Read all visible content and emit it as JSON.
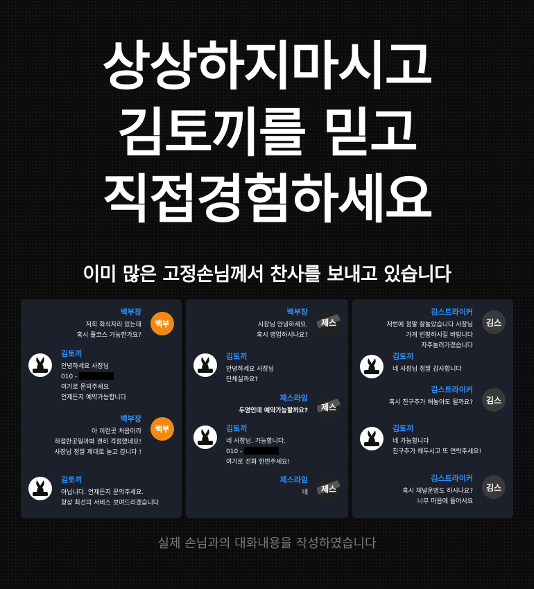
{
  "headline": {
    "line1": "상상하지마시고",
    "line2": "김토끼를 믿고",
    "line3": "직접경험하세요"
  },
  "subhead": "이미 많은 고정손님께서 찬사를 보내고 있습니다",
  "footer": "실제 손님과의 대화내용을 작성하였습니다",
  "colors": {
    "name_blue": "#2f8fff",
    "avatar_orange": "#f28a12",
    "panel_bg": "#1b202a",
    "background": "#0b0b0c"
  },
  "panels": [
    {
      "messages": [
        {
          "sender": "백부장",
          "lines": [
            "저희 회식자리 있는데",
            "혹시 풀코스 가능한가요?"
          ],
          "avatar_label": "백부"
        },
        {
          "sender": "김토끼",
          "lines": [
            "안녕하세요 사장님",
            "010 -",
            "여기로 문의주세요",
            "언제든지 예약가능합니다"
          ],
          "avatar_icon": "bunny-logo-icon"
        },
        {
          "sender": "백부장",
          "lines": [
            "아 이런곳 처음이라",
            "하접한곳일까봐 괜히 걱정했네요!",
            "사장님 정말 제대로 놀고 갑니다 !"
          ],
          "avatar_label": "백부"
        },
        {
          "sender": "김토끼",
          "lines": [
            "아닙니다. 언제든지 문의주세요.",
            "항상 최선의 서비스 보여드리겠습니다"
          ],
          "avatar_icon": "bunny-logo-icon"
        }
      ]
    },
    {
      "messages": [
        {
          "sender": "백부장",
          "lines": [
            "사장님 안녕하세요.",
            "혹시 영업하시나요?"
          ],
          "avatar_label": "제스"
        },
        {
          "sender": "김토끼",
          "lines": [
            "안녕하세요 사장님",
            "단체실까요?"
          ],
          "avatar_icon": "bunny-logo-icon"
        },
        {
          "sender": "제스라임",
          "lines": [
            "두명인데 예약가능할까요?"
          ],
          "avatar_label": "제스"
        },
        {
          "sender": "김토끼",
          "lines": [
            "네 사장님. 가능합니다.",
            "010 -",
            "여기로 전화 한번주세요!"
          ],
          "avatar_icon": "bunny-logo-icon"
        },
        {
          "sender": "제스라임",
          "lines": [
            "네"
          ],
          "avatar_label": "제스"
        }
      ]
    },
    {
      "messages": [
        {
          "sender": "김스트라이커",
          "lines": [
            "저번에 정말 잘놀았습니다 사장님",
            "가게 번창하시길 바랍니다",
            "자주놀러가겠습니다"
          ],
          "avatar_label": "김스"
        },
        {
          "sender": "김토끼",
          "lines": [
            "네 사장님 정말 감사합니다"
          ],
          "avatar_icon": "bunny-logo-icon"
        },
        {
          "sender": "김스트라이커",
          "lines": [
            "혹시 친구추가 해놓아도 될까요?"
          ],
          "avatar_label": "김스"
        },
        {
          "sender": "김토끼",
          "lines": [
            "네 가능합니다",
            "친구추가 해두시고 또 연락주세요!"
          ],
          "avatar_icon": "bunny-logo-icon"
        },
        {
          "sender": "김스트라이커",
          "lines": [
            "혹시 채널운영도 하시나요?",
            "너무 마음에 들어서요"
          ],
          "avatar_label": "김스"
        }
      ]
    }
  ]
}
